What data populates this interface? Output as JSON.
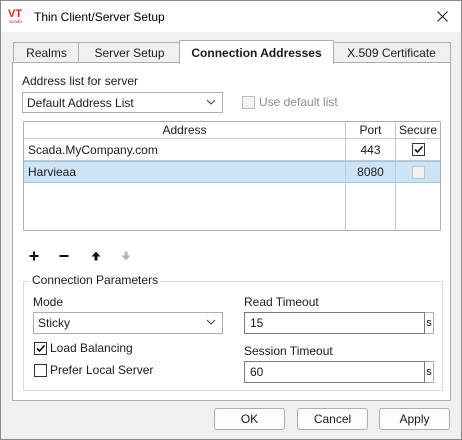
{
  "window": {
    "title": "Thin Client/Server Setup",
    "logo_icon": "vt-scada-logo-icon",
    "logo_text": "VT Scada"
  },
  "tabs": [
    {
      "label": "Realms",
      "active": false
    },
    {
      "label": "Server Setup",
      "active": false
    },
    {
      "label": "Connection Addresses",
      "active": true
    },
    {
      "label": "X.509 Certificate",
      "active": false
    }
  ],
  "address_list": {
    "label": "Address list for server",
    "selected": "Default Address List",
    "use_default_label": "Use default list",
    "use_default_checked": false,
    "use_default_enabled": false
  },
  "table": {
    "columns": [
      "Address",
      "Port",
      "Secure"
    ],
    "rows": [
      {
        "address": "Scada.MyCompany.com",
        "port": "443",
        "secure": true,
        "selected": false
      },
      {
        "address": "Harvieaa",
        "port": "8080",
        "secure": false,
        "selected": true
      }
    ]
  },
  "toolbar": {
    "icons": [
      "add-icon",
      "remove-icon",
      "move-up-icon",
      "move-down-icon"
    ]
  },
  "connection_parameters": {
    "title": "Connection Parameters",
    "mode_label": "Mode",
    "mode_value": "Sticky",
    "load_balancing_label": "Load Balancing",
    "load_balancing_checked": true,
    "prefer_local_label": "Prefer Local Server",
    "prefer_local_checked": false,
    "read_timeout_label": "Read Timeout",
    "read_timeout_value": "15",
    "session_timeout_label": "Session Timeout",
    "session_timeout_value": "60",
    "unit": "s"
  },
  "buttons": {
    "ok": "OK",
    "cancel": "Cancel",
    "apply": "Apply"
  },
  "colors": {
    "selection": "#cce4f7",
    "logo_red": "#d9262c",
    "accent": "#0078d4"
  }
}
